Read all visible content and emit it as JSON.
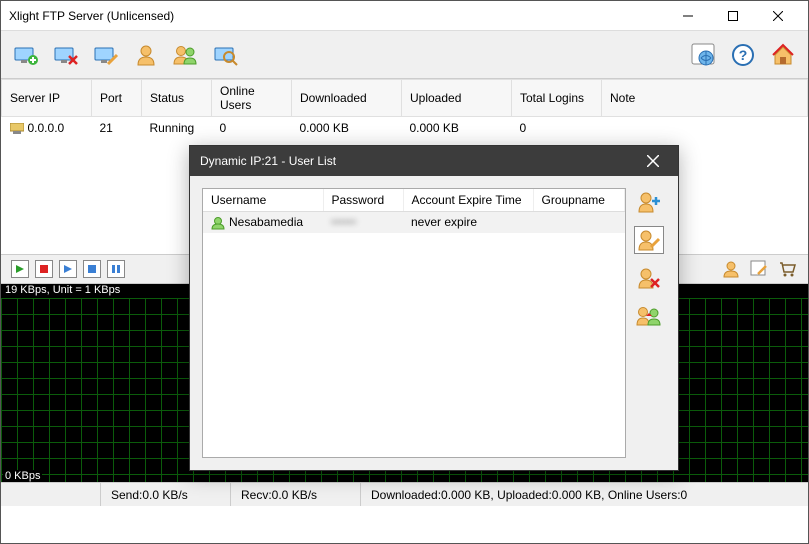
{
  "window": {
    "title": "Xlight FTP Server (Unlicensed)"
  },
  "serverTable": {
    "headers": {
      "ip": "Server IP",
      "port": "Port",
      "status": "Status",
      "online": "Online Users",
      "down": "Downloaded",
      "up": "Uploaded",
      "logins": "Total Logins",
      "note": "Note"
    },
    "row": {
      "ip": "0.0.0.0",
      "port": "21",
      "status": "Running",
      "online": "0",
      "down": "0.000 KB",
      "up": "0.000 KB",
      "logins": "0",
      "note": ""
    }
  },
  "graph": {
    "topLabel": "19 KBps, Unit = 1 KBps",
    "bottomLabel": "0 KBps"
  },
  "statusbar": {
    "send": "Send:0.0 KB/s",
    "recv": "Recv:0.0 KB/s",
    "summary": "Downloaded:0.000 KB, Uploaded:0.000 KB, Online Users:0"
  },
  "dialog": {
    "title": "Dynamic IP:21 - User List",
    "headers": {
      "username": "Username",
      "password": "Password",
      "expire": "Account Expire Time",
      "group": "Groupname"
    },
    "row": {
      "username": "Nesabamedia",
      "password": "••••••",
      "expire": "never expire",
      "group": ""
    }
  }
}
